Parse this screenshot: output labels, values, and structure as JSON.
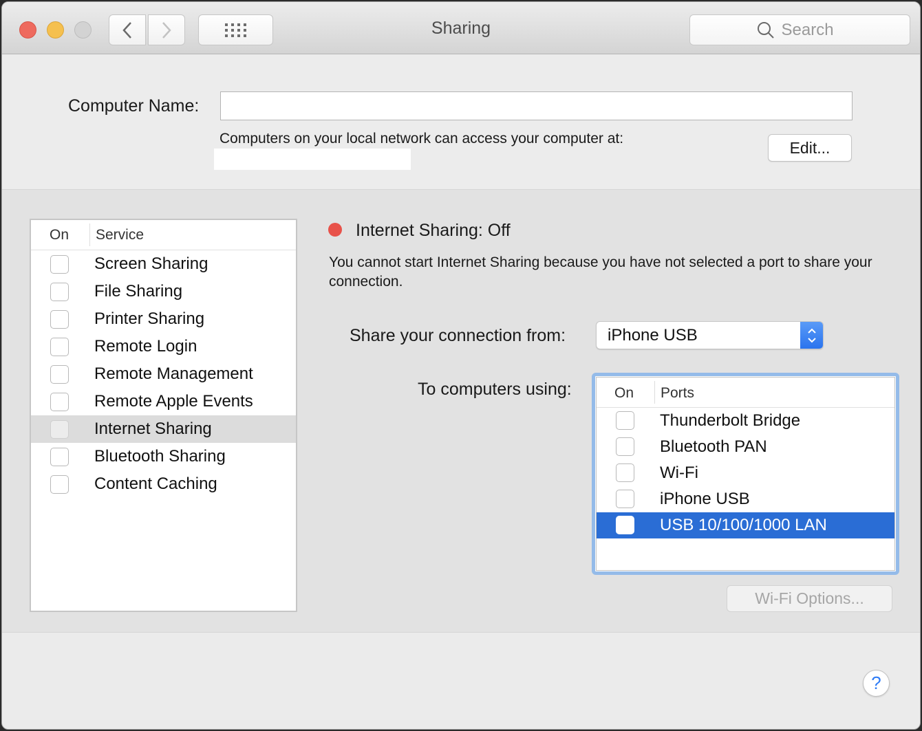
{
  "window": {
    "title": "Sharing",
    "search_placeholder": "Search",
    "icons": {
      "back": "chevron-left",
      "forward": "chevron-right",
      "show_all": "grid-dots",
      "search": "magnifying-glass"
    }
  },
  "computer_name": {
    "label": "Computer Name:",
    "value": "",
    "access_text": "Computers on your local network can access your computer at:",
    "address": "",
    "edit_button": "Edit..."
  },
  "services": {
    "header_on": "On",
    "header_service": "Service",
    "items": [
      {
        "label": "Screen Sharing",
        "on": false,
        "selected": false
      },
      {
        "label": "File Sharing",
        "on": false,
        "selected": false
      },
      {
        "label": "Printer Sharing",
        "on": false,
        "selected": false
      },
      {
        "label": "Remote Login",
        "on": false,
        "selected": false
      },
      {
        "label": "Remote Management",
        "on": false,
        "selected": false
      },
      {
        "label": "Remote Apple Events",
        "on": false,
        "selected": false
      },
      {
        "label": "Internet Sharing",
        "on": false,
        "selected": true
      },
      {
        "label": "Bluetooth Sharing",
        "on": false,
        "selected": false
      },
      {
        "label": "Content Caching",
        "on": false,
        "selected": false
      }
    ]
  },
  "detail": {
    "status_title": "Internet Sharing: Off",
    "status_color": "#e8524a",
    "status_message": "You cannot start Internet Sharing because you have not selected a port to share your connection.",
    "share_from_label": "Share your connection from:",
    "share_from_value": "iPhone USB",
    "to_computers_label": "To computers using:",
    "ports_header_on": "On",
    "ports_header_name": "Ports",
    "ports": [
      {
        "label": "Thunderbolt Bridge",
        "on": false,
        "selected": false
      },
      {
        "label": "Bluetooth PAN",
        "on": false,
        "selected": false
      },
      {
        "label": "Wi-Fi",
        "on": false,
        "selected": false
      },
      {
        "label": "iPhone USB",
        "on": false,
        "selected": false
      },
      {
        "label": "USB 10/100/1000 LAN",
        "on": false,
        "selected": true
      }
    ],
    "wifi_options_button": "Wi-Fi Options...",
    "wifi_options_enabled": false
  },
  "help_button": "?",
  "colors": {
    "accent": "#2a6dd5",
    "focus_ring": "#94bbe9",
    "close": "#ee6a5e",
    "minimize": "#f5c04f",
    "zoom": "#d3d3d3"
  }
}
